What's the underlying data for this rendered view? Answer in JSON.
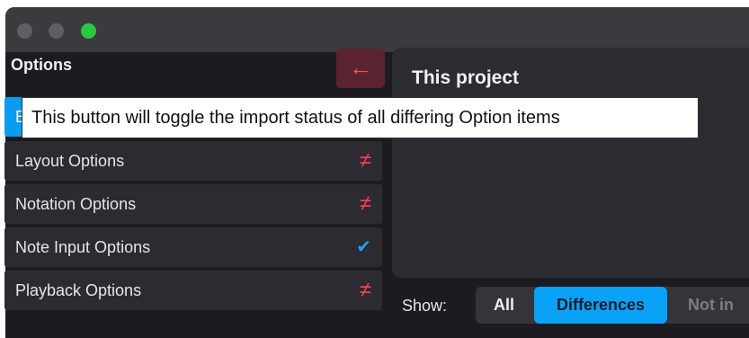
{
  "window": {
    "traffic_lights": [
      "close",
      "minimize",
      "maximize"
    ]
  },
  "sidebar": {
    "heading": "Options",
    "back_button_icon": "left-arrow-icon",
    "items": [
      {
        "label": "B",
        "status": "",
        "selected": true
      },
      {
        "label": "Layout Options",
        "status": "≠"
      },
      {
        "label": "Notation Options",
        "status": "≠"
      },
      {
        "label": "Note Input Options",
        "status": "✔"
      },
      {
        "label": "Playback Options",
        "status": "≠"
      }
    ]
  },
  "tooltip": {
    "text": "This button will toggle the import status of all differing Option items"
  },
  "panel": {
    "title": "This project"
  },
  "filter": {
    "label": "Show:",
    "segments": [
      "All",
      "Differences",
      "Not in"
    ],
    "selected": "Differences"
  },
  "colors": {
    "accent": "#0a9cf0",
    "diff": "#ff3a55",
    "back_button_bg": "#5a2330"
  }
}
